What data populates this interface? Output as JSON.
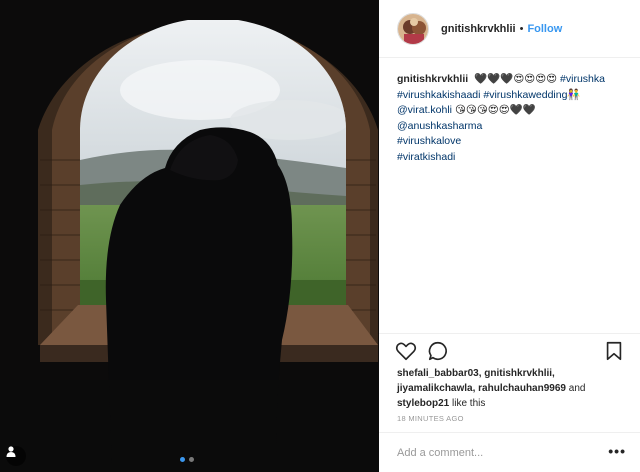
{
  "post": {
    "user_tag_icon": "person-icon",
    "carousel": {
      "count": 2,
      "active_index": 0
    }
  },
  "header": {
    "username": "gnitishkrvkhlii",
    "separator": "•",
    "follow_label": "Follow"
  },
  "caption": {
    "username": "gnitishkrvkhlii",
    "emojis_1": "🖤🖤🖤😍😍😍😍",
    "tag_virushka": "#virushka",
    "line_2": "#virushkakishaadi #virushkawedding👫",
    "line_3_mention": "@virat.kohli",
    "line_3_emojis": "😘😘😘😍😍🖤🖤",
    "line_4": "@anushkasharma",
    "line_5": "#virushkalove",
    "line_6": "#viratkishadi"
  },
  "actions": {
    "like_icon": "heart-icon",
    "comment_icon": "comment-icon",
    "save_icon": "bookmark-icon"
  },
  "likes": {
    "names_1": "shefali_babbar03, gnitishkrvkhlii,",
    "names_2": "jiyamalikchawla, rahulchauhan9969",
    "and_text": " and",
    "names_3": "stylebop21",
    "suffix": " like this"
  },
  "timestamp": "18 MINUTES AGO",
  "comment": {
    "placeholder": "Add a comment...",
    "more_label": "•••"
  },
  "colors": {
    "link": "#003569",
    "follow": "#3897f0",
    "muted": "#999999"
  }
}
